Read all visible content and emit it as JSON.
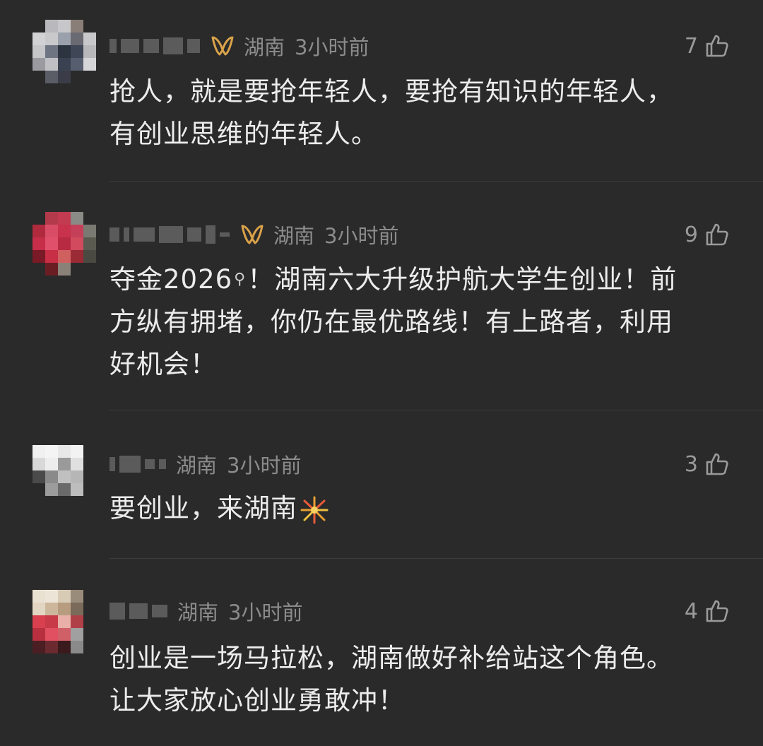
{
  "comments": [
    {
      "location": "湖南",
      "time": "3小时前",
      "likes": "7",
      "text_lines": [
        "抢人，就是要抢年轻人，要抢有知识的年轻人，",
        "有创业思维的年轻人。"
      ],
      "has_badge": true
    },
    {
      "location": "湖南",
      "time": "3小时前",
      "likes": "9",
      "text_lines": [
        "夺金2026",
        "！湖南六大升级护航大学生创业！前",
        "方纵有拥堵，你仍在最优路线！有上路者，利用",
        "好机会！"
      ],
      "has_badge": true
    },
    {
      "location": "湖南",
      "time": "3小时前",
      "likes": "3",
      "text_lines": [
        "要创业，来湖南"
      ],
      "has_badge": false
    },
    {
      "location": "湖南",
      "time": "3小时前",
      "likes": "4",
      "text_lines": [
        "创业是一场马拉松，湖南做好补给站这个角色。",
        "让大家放心创业勇敢冲！"
      ],
      "has_badge": false
    }
  ],
  "icons": {
    "like": "thumbs-up-icon",
    "badge": "gold-ribbon-badge-icon",
    "search": "search-icon",
    "fireworks": "fireworks-emoji"
  },
  "colors": {
    "background": "#2a2a2a",
    "meta_text": "#8c8c8c",
    "body_text": "#ececec",
    "badge_gold": "#d9a24a"
  }
}
